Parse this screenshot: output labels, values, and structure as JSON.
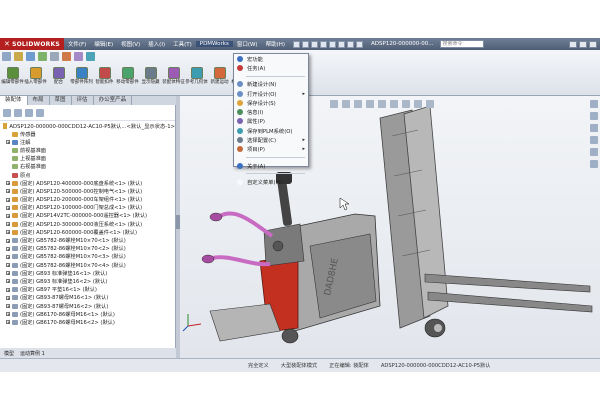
{
  "app": {
    "logo": "SOLIDWORKS",
    "document_title": "ADSP120-000000-00...",
    "help_placeholder": "搜索命令"
  },
  "menu": [
    "文件(F)",
    "编辑(E)",
    "视图(V)",
    "插入(I)",
    "工具(T)",
    "PDMWorks",
    "窗口(W)",
    "帮助(H)"
  ],
  "command_tools": [
    {
      "label": "编辑零部件",
      "color": "#5a8f3c"
    },
    {
      "label": "插入零部件",
      "color": "#d79b2e"
    },
    {
      "label": "配合",
      "color": "#7a62b3"
    },
    {
      "label": "零部件阵列",
      "color": "#3b82c4"
    },
    {
      "label": "智能扣件",
      "color": "#c24a4a"
    },
    {
      "label": "移动零部件",
      "color": "#4aa36b"
    },
    {
      "label": "显示隐藏",
      "color": "#6b7b8c"
    },
    {
      "label": "装配体特征",
      "color": "#9c5bb5"
    },
    {
      "label": "参考几何体",
      "color": "#3d9db0"
    },
    {
      "label": "新建运动",
      "color": "#d3683a"
    },
    {
      "label": "材料明细表",
      "color": "#59884a"
    },
    {
      "label": "爆炸视图",
      "color": "#b08a2a"
    }
  ],
  "panel_tabs": [
    "装配体",
    "布局",
    "草图",
    "评估",
    "办公室产品"
  ],
  "tree": {
    "root": "ADSP120-000000-000CDD12-AC10-P5默认...<默认_显示状态-1>",
    "nodes": [
      {
        "label": "传感器",
        "color": "#d8a43a",
        "expand": false
      },
      {
        "label": "注解",
        "color": "#5b84c4",
        "expand": true
      },
      {
        "label": "前视基准面",
        "color": "#8fb36a",
        "expand": false
      },
      {
        "label": "上视基准面",
        "color": "#8fb36a",
        "expand": false
      },
      {
        "label": "右视基准面",
        "color": "#8fb36a",
        "expand": false
      },
      {
        "label": "原点",
        "color": "#c95050",
        "expand": false
      },
      {
        "label": "(固定) ADSP120-400000-000底盘系统<1> (默认)",
        "color": "#d89a3a",
        "expand": true
      },
      {
        "label": "(固定) ADSP120-500000-000控制电气<1> (默认)",
        "color": "#d89a3a",
        "expand": true
      },
      {
        "label": "(固定) ADSP120-200000-000车架组件<1> (默认)",
        "color": "#d89a3a",
        "expand": true
      },
      {
        "label": "(固定) ADSP120-100000-000门架总成<1> (默认)",
        "color": "#d89a3a",
        "expand": true
      },
      {
        "label": "(固定) ADSP14V2TC-000000-000遥控器<1> (默认)",
        "color": "#d89a3a",
        "expand": true
      },
      {
        "label": "(固定) ADSP120-300000-000液压系统<1> (默认)",
        "color": "#d89a3a",
        "expand": true
      },
      {
        "label": "(固定) ADSP120-600000-000覆盖件<1> (默认)",
        "color": "#d89a3a",
        "expand": true
      },
      {
        "label": "(固定) GB5782-86螺栓M10×70<1> (默认)",
        "color": "#8a9db5",
        "expand": true
      },
      {
        "label": "(固定) GB5782-86螺栓M10×70<2> (默认)",
        "color": "#8a9db5",
        "expand": true
      },
      {
        "label": "(固定) GB5782-86螺栓M10×70<3> (默认)",
        "color": "#8a9db5",
        "expand": true
      },
      {
        "label": "(固定) GB5782-86螺栓M10×70<4> (默认)",
        "color": "#8a9db5",
        "expand": true
      },
      {
        "label": "(固定) GB93 标准弹垫16<1> (默认)",
        "color": "#8a9db5",
        "expand": true
      },
      {
        "label": "(固定) GB93 标准弹垫16<2> (默认)",
        "color": "#8a9db5",
        "expand": true
      },
      {
        "label": "(固定) GB97 平垫16<1> (默认)",
        "color": "#8a9db5",
        "expand": true
      },
      {
        "label": "(固定) GB93-87螺母M16<1> (默认)",
        "color": "#8a9db5",
        "expand": true
      },
      {
        "label": "(固定) GB93-87螺母M16<2> (默认)",
        "color": "#8a9db5",
        "expand": true
      },
      {
        "label": "(固定) GB6170-86螺母M16<1> (默认)",
        "color": "#8a9db5",
        "expand": true
      },
      {
        "label": "(固定) GB6170-86螺母M16<2> (默认)",
        "color": "#8a9db5",
        "expand": true
      }
    ]
  },
  "dropdown": {
    "items": [
      {
        "label": "宏功能",
        "color": "#3b6fc0",
        "submenu": false
      },
      {
        "label": "任务(A)",
        "color": "#c43a3a",
        "submenu": false
      },
      {
        "label": "",
        "separator": true
      },
      {
        "label": "新建设计(N)",
        "color": "#6a8fc4",
        "submenu": false
      },
      {
        "label": "打开设计(O)",
        "color": "#6a8fc4",
        "submenu": true
      },
      {
        "label": "保存设计(S)",
        "color": "#e0a43a",
        "submenu": false
      },
      {
        "label": "信息(I)",
        "color": "#4a8f5c",
        "submenu": false
      },
      {
        "label": "属性(P)",
        "color": "#7a62b3",
        "submenu": false
      },
      {
        "label": "保存到PLM系统(O)",
        "color": "#3d9db0",
        "submenu": false
      },
      {
        "label": "选择配置(C)",
        "color": "#6b7b8c",
        "submenu": true
      },
      {
        "label": "项目(P)",
        "color": "#c46a3a",
        "submenu": true
      },
      {
        "label": "",
        "separator": true
      },
      {
        "label": "关于(A)",
        "color": "#3b6fc0",
        "submenu": false
      },
      {
        "label": "",
        "separator": true
      },
      {
        "label": "自定义菜单(M)",
        "color": "#f8f9fb",
        "submenu": false
      }
    ]
  },
  "model_tabs": [
    "模型",
    "运动算例 1"
  ],
  "status": {
    "items": [
      "完全定义",
      "大型装配体模式",
      "正在编辑: 装配体",
      "ADSP120-000000-000CDD12-AC10-P5默认"
    ]
  }
}
